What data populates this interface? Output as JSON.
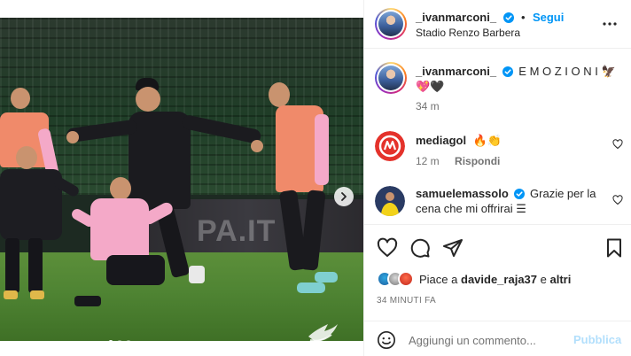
{
  "post": {
    "author": "_ivanmarconi_",
    "follow_label": "Segui",
    "location": "Stadio Renzo Barbera",
    "media_banner_text": "PA.IT",
    "media_page_count": 3,
    "media_current_page": 1
  },
  "caption": {
    "author": "_ivanmarconi_",
    "text": "E M O Z I O N I 🦅",
    "text_line2": "💖🖤",
    "time": "34 m"
  },
  "comments": [
    {
      "author": "mediagol",
      "text": "🔥👏",
      "time": "12 m",
      "reply_label": "Rispondi"
    },
    {
      "author": "samuelemassolo",
      "text": "Grazie per la cena che mi offrirai ",
      "emoji": "☰"
    }
  ],
  "likes": {
    "prefix": "Piace a",
    "user": "davide_raja37",
    "conjunction": "e",
    "others": "altri"
  },
  "timestamp": "34 MINUTI FA",
  "comment_box": {
    "placeholder": "Aggiungi un commento...",
    "publish_label": "Pubblica"
  },
  "colors": {
    "accent": "#0095f6",
    "publish_disabled": "#b2dffc",
    "verified": "#0095f6",
    "border": "#efefef",
    "jersey_pink": "#f4a9c8",
    "bib_orange": "#f08a6a"
  },
  "icons": [
    "verified-icon",
    "more-options-icon",
    "heart-icon",
    "comment-icon",
    "share-icon",
    "bookmark-icon",
    "emoji-icon",
    "chevron-right-icon"
  ]
}
